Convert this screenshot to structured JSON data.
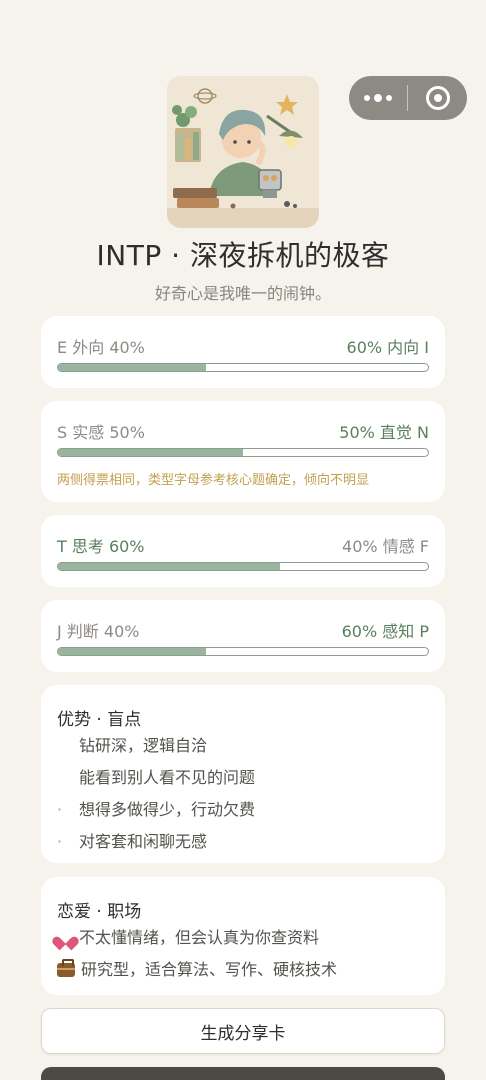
{
  "header": {
    "title": "INTP · 深夜拆机的极客",
    "subtitle": "好奇心是我唯一的闹钟。"
  },
  "dimensions": [
    {
      "left_label": "E 外向 40%",
      "right_label": "60% 内向 I",
      "left_fraction": 0.4,
      "highlight": "right"
    },
    {
      "left_label": "S 实感 50%",
      "right_label": "50% 直觉 N",
      "left_fraction": 0.5,
      "highlight": "right",
      "note": "两侧得票相同，类型字母参考核心题确定，倾向不明显"
    },
    {
      "left_label": "T 思考 60%",
      "right_label": "40% 情感 F",
      "left_fraction": 0.6,
      "highlight": "left"
    },
    {
      "left_label": "J 判断 40%",
      "right_label": "60% 感知 P",
      "left_fraction": 0.4,
      "highlight": "right"
    }
  ],
  "strengths": {
    "title": "优势 · 盲点",
    "items": [
      {
        "marker": "",
        "text": "钻研深，逻辑自洽"
      },
      {
        "marker": "",
        "text": "能看到别人看不见的问题"
      },
      {
        "marker": "·",
        "text": "想得多做得少，行动欠费"
      },
      {
        "marker": "·",
        "text": "对客套和闲聊无感"
      }
    ]
  },
  "love_work": {
    "title": "恋爱 · 职场",
    "items": [
      {
        "icon": "heart-icon",
        "text": "不太懂情绪，但会认真为你查资料"
      },
      {
        "icon": "briefcase-icon",
        "text": "研究型，适合算法、写作、硬核技术"
      }
    ]
  },
  "actions": {
    "share_label": "生成分享卡"
  },
  "colors": {
    "background": "#f6f2ec",
    "accent_green": "#5a7f5f",
    "bar_fill": "#9ab59e",
    "note_gold": "#c3a04f"
  }
}
